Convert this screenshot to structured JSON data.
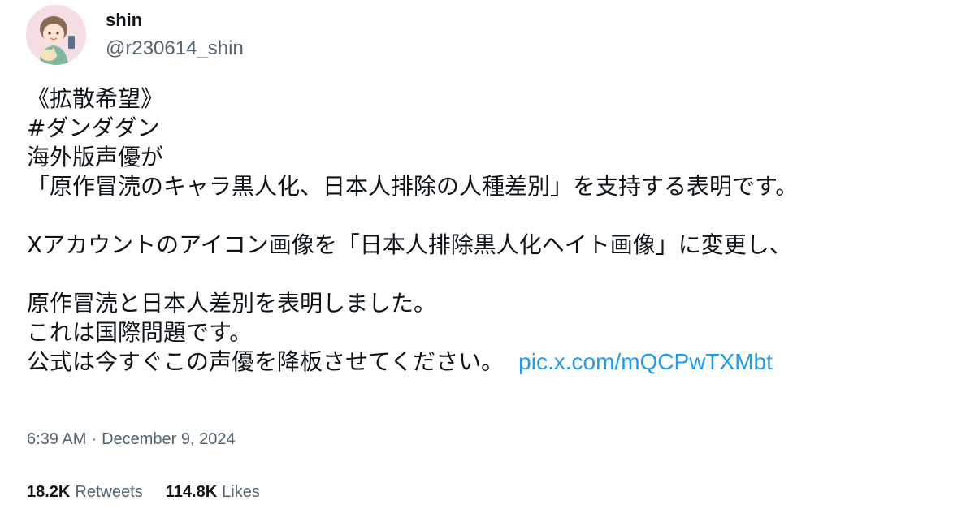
{
  "author": {
    "display_name": "shin",
    "handle": "@r230614_shin"
  },
  "tweet": {
    "lines": [
      "《拡散希望》",
      "#ダンダダン",
      "海外版声優が",
      "「原作冒涜のキャラ黒人化、日本人排除の人種差別」を支持する表明です。",
      "",
      "Xアカウントのアイコン画像を「日本人排除黒人化ヘイト画像」に変更し、",
      "",
      "原作冒涜と日本人差別を表明しました。",
      "これは国際問題です。",
      "公式は今すぐこの声優を降板させてください。"
    ],
    "link": "pic.x.com/mQCPwTXMbt"
  },
  "meta": {
    "time": "6:39 AM",
    "separator": "·",
    "date": "December 9, 2024"
  },
  "stats": {
    "retweets_count": "18.2K",
    "retweets_label": "Retweets",
    "likes_count": "114.8K",
    "likes_label": "Likes"
  },
  "colors": {
    "text": "#0f1419",
    "secondary": "#536471",
    "link": "#1d9bf0",
    "avatar_bg": "#f6dde3"
  }
}
